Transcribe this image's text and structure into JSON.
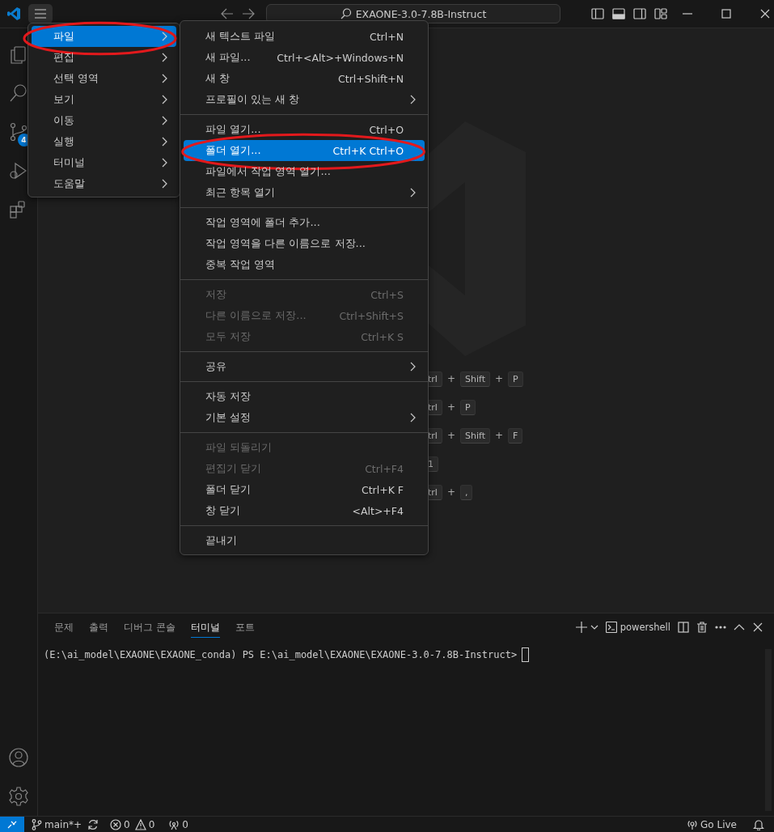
{
  "title_bar": {
    "search": "EXAONE-3.0-7.8B-Instruct"
  },
  "activity_bar": {
    "source_control_badge": "4"
  },
  "welcome_shortcuts": [
    {
      "parts": [
        {
          "kind": "key",
          "text": "trl"
        },
        {
          "kind": "plus",
          "text": "+"
        },
        {
          "kind": "key",
          "text": "Shift"
        },
        {
          "kind": "plus",
          "text": "+"
        },
        {
          "kind": "key",
          "text": "P"
        }
      ]
    },
    {
      "parts": [
        {
          "kind": "key",
          "text": "trl"
        },
        {
          "kind": "plus",
          "text": "+"
        },
        {
          "kind": "key",
          "text": "P"
        }
      ]
    },
    {
      "parts": [
        {
          "kind": "key",
          "text": "trl"
        },
        {
          "kind": "plus",
          "text": "+"
        },
        {
          "kind": "key",
          "text": "Shift"
        },
        {
          "kind": "plus",
          "text": "+"
        },
        {
          "kind": "key",
          "text": "F"
        }
      ]
    },
    {
      "parts": [
        {
          "kind": "key",
          "text": "1"
        }
      ]
    },
    {
      "parts": [
        {
          "kind": "key",
          "text": "trl"
        },
        {
          "kind": "plus",
          "text": "+"
        },
        {
          "kind": "key",
          "text": ","
        }
      ]
    }
  ],
  "menu": {
    "items": [
      {
        "label": "파일",
        "selected": true,
        "circled": true
      },
      {
        "label": "편집",
        "selected": false,
        "circled": false
      },
      {
        "label": "선택 영역",
        "selected": false,
        "circled": false
      },
      {
        "label": "보기",
        "selected": false,
        "circled": false
      },
      {
        "label": "이동",
        "selected": false,
        "circled": false
      },
      {
        "label": "실행",
        "selected": false,
        "circled": false
      },
      {
        "label": "터미널",
        "selected": false,
        "circled": false
      },
      {
        "label": "도움말",
        "selected": false,
        "circled": false
      }
    ]
  },
  "submenu": {
    "groups": [
      [
        {
          "label": "새 텍스트 파일",
          "shortcut": "Ctrl+N",
          "disabled": false,
          "has_submenu": false,
          "selected": false,
          "circled": false
        },
        {
          "label": "새 파일...",
          "shortcut": "Ctrl+<Alt>+Windows+N",
          "disabled": false,
          "has_submenu": false,
          "selected": false,
          "circled": false
        },
        {
          "label": "새 창",
          "shortcut": "Ctrl+Shift+N",
          "disabled": false,
          "has_submenu": false,
          "selected": false,
          "circled": false
        },
        {
          "label": "프로필이 있는 새 창",
          "disabled": false,
          "has_submenu": true,
          "selected": false,
          "circled": false
        }
      ],
      [
        {
          "label": "파일 열기...",
          "shortcut": "Ctrl+O",
          "disabled": false,
          "has_submenu": false,
          "selected": false,
          "circled": false
        },
        {
          "label": "폴더 열기...",
          "shortcut": "Ctrl+K Ctrl+O",
          "disabled": false,
          "has_submenu": false,
          "selected": true,
          "circled": true
        },
        {
          "label": "파일에서 작업 영역 열기...",
          "disabled": false,
          "has_submenu": false,
          "selected": false,
          "circled": false
        },
        {
          "label": "최근 항목 열기",
          "disabled": false,
          "has_submenu": true,
          "selected": false,
          "circled": false
        }
      ],
      [
        {
          "label": "작업 영역에 폴더 추가...",
          "disabled": false,
          "has_submenu": false,
          "selected": false,
          "circled": false
        },
        {
          "label": "작업 영역을 다른 이름으로 저장...",
          "disabled": false,
          "has_submenu": false,
          "selected": false,
          "circled": false
        },
        {
          "label": "중복 작업 영역",
          "disabled": false,
          "has_submenu": false,
          "selected": false,
          "circled": false
        }
      ],
      [
        {
          "label": "저장",
          "shortcut": "Ctrl+S",
          "disabled": true,
          "has_submenu": false,
          "selected": false,
          "circled": false
        },
        {
          "label": "다른 이름으로 저장...",
          "shortcut": "Ctrl+Shift+S",
          "disabled": true,
          "has_submenu": false,
          "selected": false,
          "circled": false
        },
        {
          "label": "모두 저장",
          "shortcut": "Ctrl+K S",
          "disabled": true,
          "has_submenu": false,
          "selected": false,
          "circled": false
        }
      ],
      [
        {
          "label": "공유",
          "disabled": false,
          "has_submenu": true,
          "selected": false,
          "circled": false
        }
      ],
      [
        {
          "label": "자동 저장",
          "disabled": false,
          "has_submenu": false,
          "selected": false,
          "circled": false
        },
        {
          "label": "기본 설정",
          "disabled": false,
          "has_submenu": true,
          "selected": false,
          "circled": false
        }
      ],
      [
        {
          "label": "파일 되돌리기",
          "disabled": true,
          "has_submenu": false,
          "selected": false,
          "circled": false
        },
        {
          "label": "편집기 닫기",
          "shortcut": "Ctrl+F4",
          "disabled": true,
          "has_submenu": false,
          "selected": false,
          "circled": false
        },
        {
          "label": "폴더 닫기",
          "shortcut": "Ctrl+K F",
          "disabled": false,
          "has_submenu": false,
          "selected": false,
          "circled": false
        },
        {
          "label": "창 닫기",
          "shortcut": "<Alt>+F4",
          "disabled": false,
          "has_submenu": false,
          "selected": false,
          "circled": false
        }
      ],
      [
        {
          "label": "끝내기",
          "disabled": false,
          "has_submenu": false,
          "selected": false,
          "circled": false
        }
      ]
    ]
  },
  "panel": {
    "tabs": [
      {
        "label": "문제",
        "selected": false
      },
      {
        "label": "출력",
        "selected": false
      },
      {
        "label": "디버그 콘솔",
        "selected": false
      },
      {
        "label": "터미널",
        "selected": true
      },
      {
        "label": "포트",
        "selected": false
      }
    ],
    "terminal_profile": "powershell",
    "terminal_line": "(E:\\ai_model\\EXAONE\\EXAONE_conda) PS E:\\ai_model\\EXAONE\\EXAONE-3.0-7.8B-Instruct>"
  },
  "status_bar": {
    "branch": "main*+",
    "errors": "0",
    "warnings": "0",
    "ports": "0",
    "go_live": "Go Live"
  }
}
